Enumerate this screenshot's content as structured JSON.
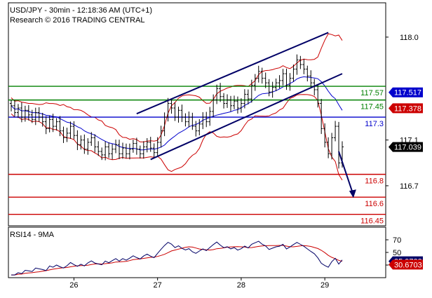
{
  "header": {
    "line1": "USD/JPY - 30min - 12:18:36 AM (UTC+1)",
    "line2": "Research © 2016 TRADING CENTRAL"
  },
  "chart_data": {
    "type": "candlestick",
    "symbol": "USD/JPY",
    "timeframe": "30min",
    "price_axis": {
      "ylim": [
        116.35,
        118.3
      ],
      "ticks": [
        118.0,
        117.1,
        116.7
      ]
    },
    "x_labels": [
      {
        "label": "26",
        "index": 18
      },
      {
        "label": "27",
        "index": 42
      },
      {
        "label": "28",
        "index": 66
      },
      {
        "label": "29",
        "index": 90
      }
    ],
    "levels": [
      {
        "label": "117.57",
        "value": 117.57,
        "color": "#008000"
      },
      {
        "label": "117.45",
        "value": 117.45,
        "color": "#008000"
      },
      {
        "label": "117.3",
        "value": 117.3,
        "color": "#0000cc"
      },
      {
        "label": "116.8",
        "value": 116.8,
        "color": "#cc0000"
      },
      {
        "label": "116.6",
        "value": 116.6,
        "color": "#cc0000"
      },
      {
        "label": "116.45",
        "value": 116.45,
        "color": "#cc0000"
      }
    ],
    "price_tags": [
      {
        "label": "117.517",
        "value": 117.517,
        "color": "#0000cc"
      },
      {
        "label": "117.378",
        "value": 117.378,
        "color": "#cc0000"
      },
      {
        "label": "117.039",
        "value": 117.039,
        "color": "#000000"
      }
    ],
    "channel": {
      "upper": [
        [
          36,
          117.33
        ],
        [
          91,
          118.04
        ]
      ],
      "lower": [
        [
          40,
          116.93
        ],
        [
          95,
          117.68
        ]
      ],
      "color": "#000066"
    },
    "projection": {
      "from": [
        94,
        117.0
      ],
      "to": [
        98,
        116.6
      ],
      "color": "#000066"
    },
    "close": [
      117.4,
      117.34,
      117.38,
      117.3,
      117.36,
      117.32,
      117.28,
      117.34,
      117.3,
      117.26,
      117.2,
      117.28,
      117.22,
      117.26,
      117.18,
      117.12,
      117.16,
      117.22,
      117.14,
      117.06,
      117.1,
      117.02,
      117.08,
      117.12,
      117.04,
      117.0,
      116.97,
      117.04,
      116.98,
      117.02,
      117.06,
      116.98,
      117.03,
      116.98,
      117.02,
      117.07,
      117.02,
      116.98,
      117.04,
      117.08,
      117.03,
      116.99,
      117.08,
      117.18,
      117.3,
      117.42,
      117.38,
      117.3,
      117.36,
      117.3,
      117.26,
      117.3,
      117.22,
      117.18,
      117.24,
      117.3,
      117.26,
      117.35,
      117.45,
      117.55,
      117.48,
      117.42,
      117.45,
      117.4,
      117.44,
      117.38,
      117.42,
      117.5,
      117.46,
      117.58,
      117.64,
      117.7,
      117.64,
      117.6,
      117.52,
      117.56,
      117.6,
      117.62,
      117.68,
      117.58,
      117.64,
      117.72,
      117.8,
      117.76,
      117.72,
      117.66,
      117.6,
      117.54,
      117.42,
      117.2,
      117.08,
      116.98,
      117.12,
      117.22,
      116.9,
      117.04
    ],
    "rsi_panel": {
      "title": "RSI14 - 9MA",
      "ylim": [
        10,
        90
      ],
      "ticks": [
        70,
        50,
        30
      ],
      "tags": [
        {
          "label": "35.9723",
          "value": 35.9723,
          "color": "#000066"
        },
        {
          "label": "30.6703",
          "value": 30.6703,
          "color": "#cc0000"
        }
      ]
    }
  }
}
